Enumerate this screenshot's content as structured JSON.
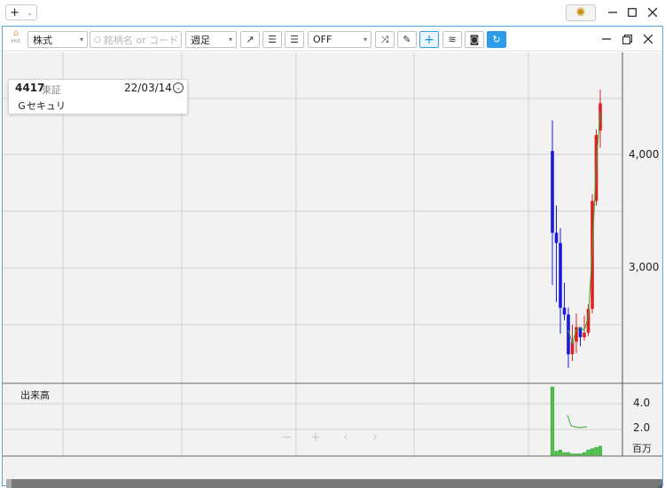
{
  "toolbar": {
    "hot_label": "Hot",
    "asset_type": "株式",
    "search_placeholder": "銘柄名 or コード",
    "period": "週足",
    "indicator": "OFF"
  },
  "info": {
    "code": "4417",
    "market": "東証",
    "date": "22/03/14",
    "name": "Ｇセキュリ"
  },
  "volume_label": "出来高",
  "price_ticks": [
    "4,000",
    "3,000"
  ],
  "volume_ticks": [
    "4.0",
    "2.0"
  ],
  "volume_unit": "百万",
  "colors": {
    "up": "#e02020",
    "down": "#1a1adc",
    "volume": "#33aa33",
    "accent": "#2c9be8"
  },
  "chart_data": {
    "type": "candlestick",
    "y_ticks": [
      3000,
      4000
    ],
    "volume_ticks": [
      2.0,
      4.0
    ],
    "volume_unit": "百万",
    "series": [
      {
        "o": 4030,
        "h": 4300,
        "l": 2850,
        "c": 3310
      },
      {
        "o": 3310,
        "h": 3550,
        "l": 2700,
        "c": 3220
      },
      {
        "o": 3220,
        "h": 3350,
        "l": 2420,
        "c": 2650
      },
      {
        "o": 2650,
        "h": 2870,
        "l": 2540,
        "c": 2590
      },
      {
        "o": 2590,
        "h": 2650,
        "l": 2120,
        "c": 2240
      },
      {
        "o": 2240,
        "h": 2500,
        "l": 2180,
        "c": 2350
      },
      {
        "o": 2350,
        "h": 2600,
        "l": 2250,
        "c": 2480
      },
      {
        "o": 2480,
        "h": 2470,
        "l": 2310,
        "c": 2390
      },
      {
        "o": 2390,
        "h": 2580,
        "l": 2360,
        "c": 2430
      },
      {
        "o": 2430,
        "h": 2680,
        "l": 2400,
        "c": 2640
      },
      {
        "o": 2640,
        "h": 3650,
        "l": 2600,
        "c": 3590
      },
      {
        "o": 3590,
        "h": 4220,
        "l": 3550,
        "c": 4170
      },
      {
        "o": 4210,
        "h": 4570,
        "l": 4060,
        "c": 4450
      }
    ],
    "volume": [
      5.3,
      0.3,
      0.4,
      0.2,
      0.2,
      0.1,
      0.1,
      0.1,
      0.2,
      0.4,
      0.5,
      0.6,
      0.7
    ]
  }
}
